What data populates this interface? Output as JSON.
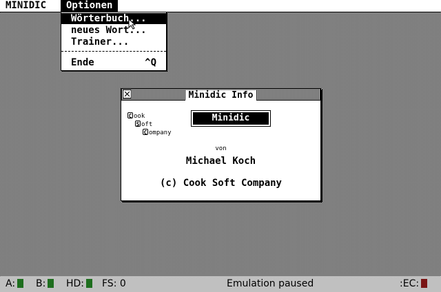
{
  "menubar": {
    "app_menu": "MINIDIC",
    "options_menu": "Optionen"
  },
  "dropdown": {
    "items": [
      {
        "label": "Wörterbuch..."
      },
      {
        "label": "neues Wort..."
      },
      {
        "label": "Trainer..."
      },
      {
        "label": "Ende",
        "shortcut": "^Q"
      }
    ]
  },
  "window": {
    "title": "Minidic Info",
    "logo_letters": [
      "C",
      "S",
      "C"
    ],
    "logo_words": [
      "ook",
      "oft",
      "ompany"
    ],
    "app_name": "Minidic",
    "by_label": "von",
    "author": "Michael Koch",
    "copyright": "(c) Cook Soft Company"
  },
  "statusbar": {
    "drive_a": "A:",
    "drive_b": "B:",
    "drive_hd": "HD:",
    "fs_label": "FS:",
    "fs_value": "0",
    "status": "Emulation paused",
    "ec_label": ":EC:",
    "led_colors": {
      "green": "#1e6e1e",
      "red": "#7a1414"
    }
  }
}
